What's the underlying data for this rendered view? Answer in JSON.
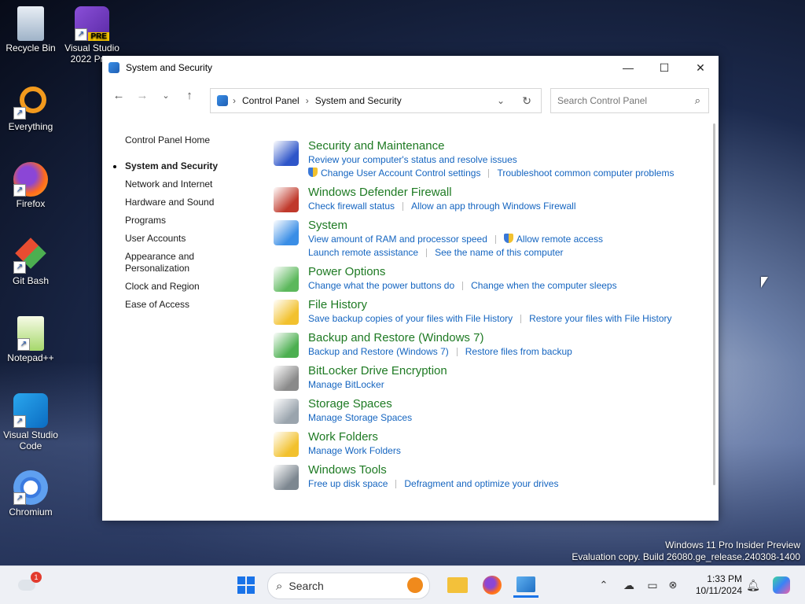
{
  "desktop": {
    "icons": [
      {
        "name": "recycle-bin",
        "label": "Recycle Bin"
      },
      {
        "name": "visual-studio-2022",
        "label": "Visual Studio 2022 Prev",
        "badge": "PRE"
      },
      {
        "name": "everything",
        "label": "Everything"
      },
      {
        "name": "firefox",
        "label": "Firefox"
      },
      {
        "name": "git-bash",
        "label": "Git Bash"
      },
      {
        "name": "notepad-plus-plus",
        "label": "Notepad++"
      },
      {
        "name": "vscode",
        "label": "Visual Studio Code"
      },
      {
        "name": "chromium",
        "label": "Chromium"
      }
    ],
    "watermark_line1": "Windows 11 Pro Insider Preview",
    "watermark_line2": "Evaluation copy. Build 26080.ge_release.240308-1400"
  },
  "window": {
    "title": "System and Security",
    "controls": {
      "minimize": "—",
      "maximize": "☐",
      "close": "✕"
    },
    "breadcrumb": [
      "Control Panel",
      "System and Security"
    ],
    "search_placeholder": "Search Control Panel",
    "sidebar": {
      "home": "Control Panel Home",
      "items": [
        "System and Security",
        "Network and Internet",
        "Hardware and Sound",
        "Programs",
        "User Accounts",
        "Appearance and Personalization",
        "Clock and Region",
        "Ease of Access"
      ],
      "current": "System and Security"
    },
    "categories": [
      {
        "title": "Security and Maintenance",
        "icon": "flag-icon",
        "rows": [
          [
            "Review your computer's status and resolve issues"
          ],
          [
            "*Change User Account Control settings",
            "Troubleshoot common computer problems"
          ]
        ]
      },
      {
        "title": "Windows Defender Firewall",
        "icon": "firewall-icon",
        "rows": [
          [
            "Check firewall status",
            "Allow an app through Windows Firewall"
          ]
        ]
      },
      {
        "title": "System",
        "icon": "monitor-icon",
        "rows": [
          [
            "View amount of RAM and processor speed",
            "*Allow remote access"
          ],
          [
            "Launch remote assistance",
            "See the name of this computer"
          ]
        ]
      },
      {
        "title": "Power Options",
        "icon": "battery-icon",
        "rows": [
          [
            "Change what the power buttons do",
            "Change when the computer sleeps"
          ]
        ]
      },
      {
        "title": "File History",
        "icon": "file-history-icon",
        "rows": [
          [
            "Save backup copies of your files with File History",
            "Restore your files with File History"
          ]
        ]
      },
      {
        "title": "Backup and Restore (Windows 7)",
        "icon": "backup-icon",
        "rows": [
          [
            "Backup and Restore (Windows 7)",
            "Restore files from backup"
          ]
        ]
      },
      {
        "title": "BitLocker Drive Encryption",
        "icon": "bitlocker-icon",
        "rows": [
          [
            "Manage BitLocker"
          ]
        ]
      },
      {
        "title": "Storage Spaces",
        "icon": "storage-icon",
        "rows": [
          [
            "Manage Storage Spaces"
          ]
        ]
      },
      {
        "title": "Work Folders",
        "icon": "work-folders-icon",
        "rows": [
          [
            "Manage Work Folders"
          ]
        ]
      },
      {
        "title": "Windows Tools",
        "icon": "tools-icon",
        "rows": [
          [
            "Free up disk space",
            "Defragment and optimize your drives"
          ]
        ]
      }
    ]
  },
  "taskbar": {
    "search_label": "Search",
    "time": "1:33 PM",
    "date": "10/11/2024",
    "weather_badge": "1"
  },
  "colors": {
    "category_title": "#1e7a23",
    "link": "#1565c0"
  }
}
